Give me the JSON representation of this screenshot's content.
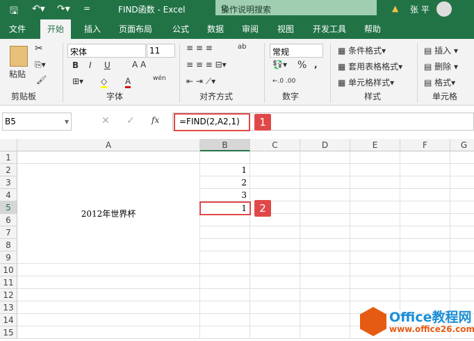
{
  "title_bar": {
    "title": "FIND函数  -  Excel",
    "search_placeholder": "操作说明搜索",
    "user": "张 平",
    "qat_more": "="
  },
  "tabs": [
    "文件",
    "开始",
    "插入",
    "页面布局",
    "公式",
    "数据",
    "审阅",
    "视图",
    "开发工具",
    "帮助"
  ],
  "ribbon": {
    "clipboard": {
      "paste": "粘贴",
      "label": "剪贴板"
    },
    "font": {
      "name": "宋体",
      "size": "11",
      "bold": "B",
      "italic": "I",
      "underline": "U",
      "label": "字体",
      "phonetic": "wén"
    },
    "alignment": {
      "label": "对齐方式"
    },
    "number": {
      "format": "常规",
      "percent": "%",
      "comma": ",",
      "label": "数字"
    },
    "styles": {
      "conditional": "条件格式",
      "table": "套用表格格式",
      "cell": "单元格样式",
      "label": "样式"
    },
    "cells": {
      "insert": "插入",
      "delete": "删除",
      "format": "格式",
      "label": "单元格"
    }
  },
  "formula_bar": {
    "name_box": "B5",
    "fx": "fx",
    "formula": "=FIND(2,A2,1)"
  },
  "annotations": [
    "1",
    "2"
  ],
  "columns": [
    "A",
    "B",
    "C",
    "D",
    "E",
    "F",
    "G"
  ],
  "rows": [
    "1",
    "2",
    "3",
    "4",
    "5",
    "6",
    "7",
    "8",
    "9",
    "10",
    "11",
    "12",
    "13",
    "14",
    "15"
  ],
  "cells": {
    "A2": "2012年世界杯",
    "B2": "1",
    "B3": "2",
    "B4": "3",
    "B5": "1"
  },
  "watermark": {
    "brand": "Office教程网",
    "url": "www.office26.com"
  }
}
